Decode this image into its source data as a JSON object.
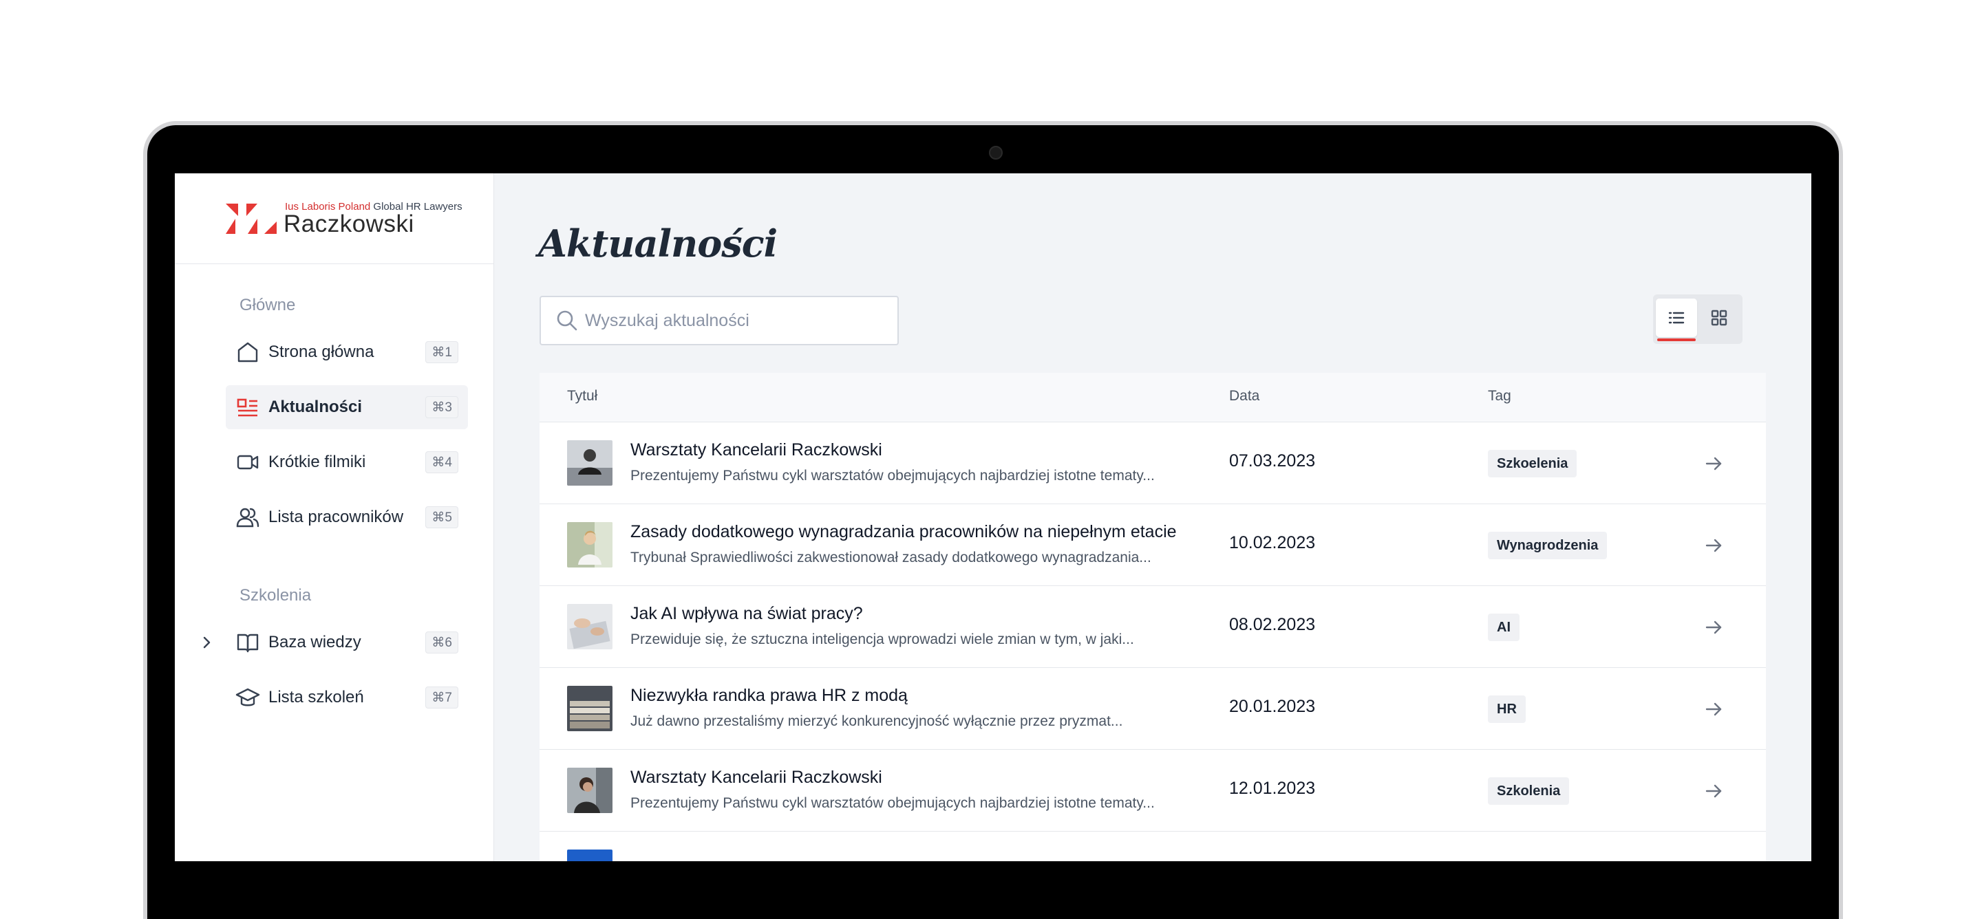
{
  "brand": {
    "tagline_red": "Ius Laboris Poland",
    "tagline_dark": " Global HR Lawyers",
    "name": "Raczkowski",
    "accent_color": "#e53935"
  },
  "sidebar": {
    "sections": [
      {
        "title": "Główne",
        "items": [
          {
            "label": "Strona główna",
            "shortcut": "⌘1",
            "icon": "home-icon"
          },
          {
            "label": "Aktualności",
            "shortcut": "⌘3",
            "icon": "news-icon",
            "active": true
          },
          {
            "label": "Krótkie filmiki",
            "shortcut": "⌘4",
            "icon": "video-icon"
          },
          {
            "label": "Lista pracowników",
            "shortcut": "⌘5",
            "icon": "users-icon"
          }
        ]
      },
      {
        "title": "Szkolenia",
        "items": [
          {
            "label": "Baza wiedzy",
            "shortcut": "⌘6",
            "icon": "book-icon",
            "expandable": true
          },
          {
            "label": "Lista szkoleń",
            "shortcut": "⌘7",
            "icon": "graduation-cap-icon"
          }
        ]
      }
    ]
  },
  "main": {
    "title": "Aktualności",
    "search": {
      "placeholder": "Wyszukaj aktualności",
      "value": ""
    },
    "view_mode": "list",
    "table": {
      "columns": [
        "Tytuł",
        "Data",
        "Tag"
      ],
      "rows": [
        {
          "title": "Warsztaty Kancelarii Raczkowski",
          "excerpt": "Prezentujemy Państwu cykl warsztatów obejmujących najbardziej istotne tematy...",
          "date": "07.03.2023",
          "tag": "Szkoelenia"
        },
        {
          "title": "Zasady dodatkowego wynagradzania pracowników na niepełnym etacie",
          "excerpt": "Trybunał Sprawiedliwości zakwestionował zasady dodatkowego wynagradzania...",
          "date": "10.02.2023",
          "tag": "Wynagrodzenia"
        },
        {
          "title": "Jak AI wpływa na świat pracy?",
          "excerpt": "Przewiduje się, że sztuczna inteligencja wprowadzi wiele zmian w tym, w jaki...",
          "date": "08.02.2023",
          "tag": "AI"
        },
        {
          "title": "Niezwykła randka prawa HR z modą",
          "excerpt": "Już dawno przestaliśmy mierzyć konkurencyjność wyłącznie przez pryzmat...",
          "date": "20.01.2023",
          "tag": "HR"
        },
        {
          "title": "Warsztaty Kancelarii Raczkowski",
          "excerpt": "Prezentujemy Państwu cykl warsztatów obejmujących najbardziej istotne tematy...",
          "date": "12.01.2023",
          "tag": "Szkolenia"
        }
      ]
    }
  }
}
